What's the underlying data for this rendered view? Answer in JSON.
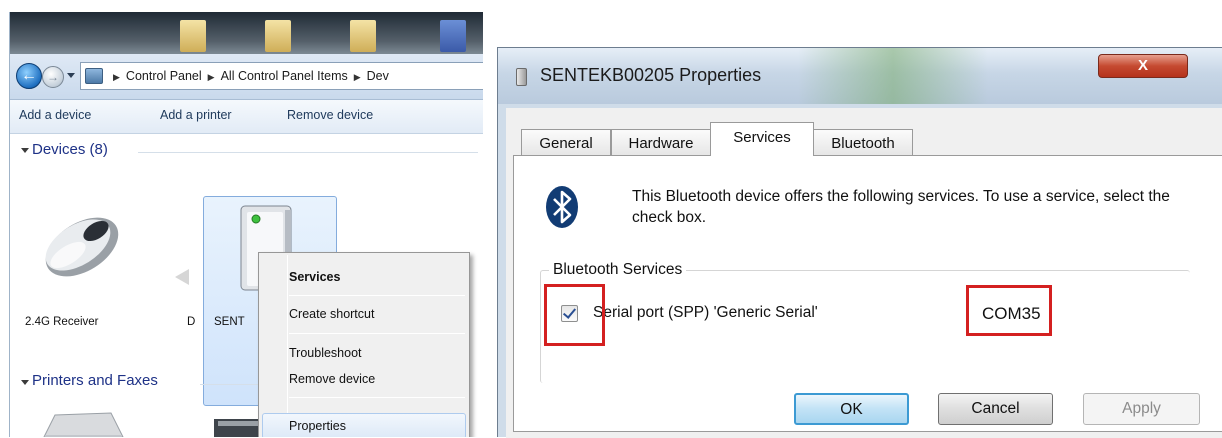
{
  "explorer": {
    "breadcrumb": [
      "Control Panel",
      "All Control Panel Items",
      "Dev"
    ],
    "commands": [
      "Add a device",
      "Add a printer",
      "Remove device"
    ],
    "devices_group": "Devices (8)",
    "printers_group": "Printers and Faxes",
    "device_labels": {
      "receiver": "2.4G Receiver",
      "d": "D",
      "sent": "SENT"
    },
    "context_menu": {
      "services": "Services",
      "create_shortcut": "Create shortcut",
      "troubleshoot": "Troubleshoot",
      "remove_device": "Remove device",
      "properties": "Properties"
    }
  },
  "dialog": {
    "title": "SENTEKB00205 Properties",
    "close_label": "X",
    "tabs": [
      "General",
      "Hardware",
      "Services",
      "Bluetooth"
    ],
    "active_tab": "Services",
    "info_text": "This Bluetooth device offers the following services. To use a service, select the check box.",
    "group_label": "Bluetooth Services",
    "service": {
      "name": "Serial port (SPP) 'Generic Serial'",
      "checked": true,
      "port": "COM35"
    },
    "buttons": {
      "ok": "OK",
      "cancel": "Cancel",
      "apply": "Apply"
    }
  },
  "colors": {
    "highlight_box": "#d42020",
    "link_text": "#1e395b",
    "group_header": "#1e3287"
  },
  "icons": [
    "back-arrow-icon",
    "forward-arrow-icon",
    "address-bar-icon",
    "mouse-device-icon",
    "computer-device-icon",
    "printer-icon",
    "device-file-icon",
    "bluetooth-icon",
    "checkbox-checked-icon"
  ]
}
